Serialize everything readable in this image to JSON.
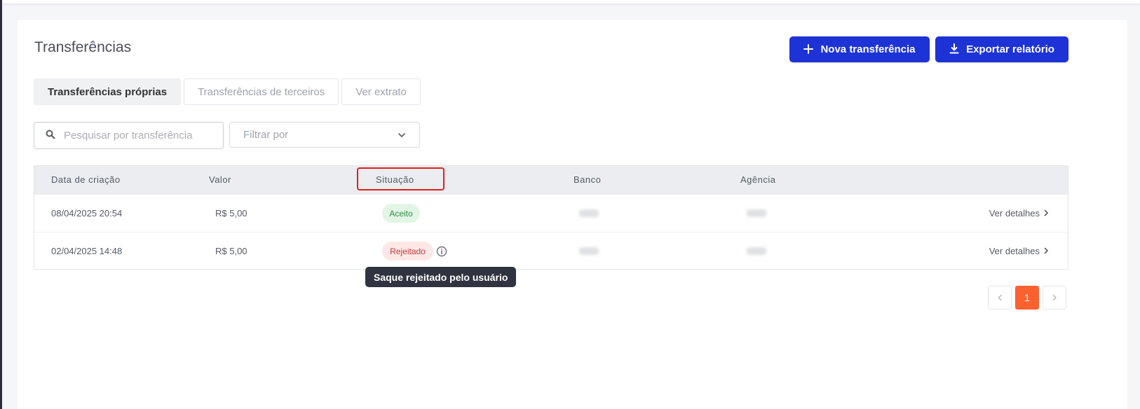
{
  "page": {
    "title": "Transferências"
  },
  "actions": {
    "new_transfer": "Nova transferência",
    "export_report": "Exportar relatório"
  },
  "tabs": [
    {
      "label": "Transferências próprias",
      "active": true
    },
    {
      "label": "Transferências de terceiros",
      "active": false
    },
    {
      "label": "Ver extrato",
      "active": false
    }
  ],
  "search": {
    "placeholder": "Pesquisar por transferência"
  },
  "filter": {
    "label": "Filtrar por"
  },
  "table": {
    "columns": [
      "Data de criação",
      "Valor",
      "Situação",
      "Banco",
      "Agência"
    ],
    "rows": [
      {
        "date": "08/04/2025 20:54",
        "value": "R$ 5,00",
        "status": "Aceito",
        "details": "Ver detalhes"
      },
      {
        "date": "02/04/2025 14:48",
        "value": "R$ 5,00",
        "status": "Rejeitado",
        "details": "Ver detalhes"
      }
    ]
  },
  "tooltip": {
    "text": "Saque rejeitado pelo usuário"
  },
  "pagination": {
    "current": "1"
  },
  "colors": {
    "primary": "#1d33d6",
    "accent": "#fa6131",
    "success_bg": "#e3f6e6",
    "danger_bg": "#fde7e7",
    "highlight": "#e02020"
  }
}
